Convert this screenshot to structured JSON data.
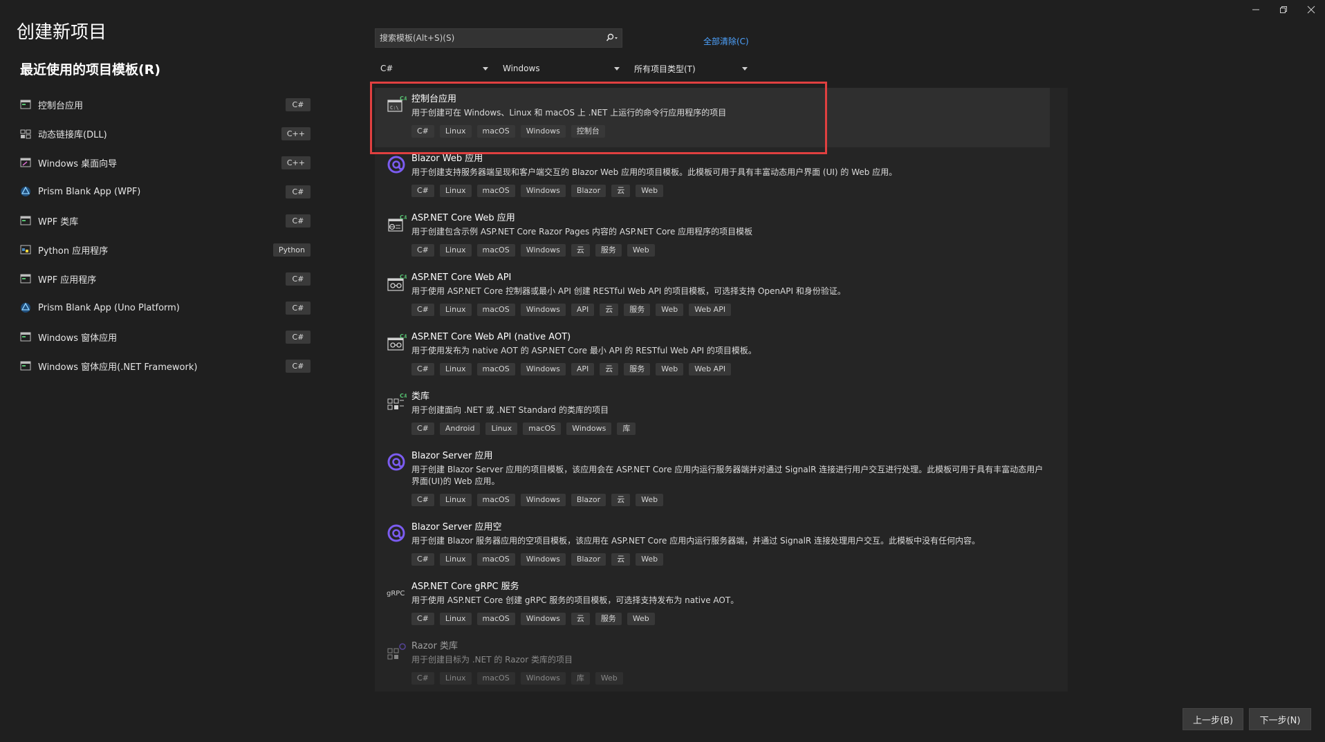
{
  "window": {
    "minimize_label": "",
    "title": "创建新项目"
  },
  "left": {
    "recent_title": "最近使用的项目模板(R)",
    "items": [
      {
        "label": "控制台应用",
        "lang": "C#"
      },
      {
        "label": "动态链接库(DLL)",
        "lang": "C++"
      },
      {
        "label": "Windows 桌面向导",
        "lang": "C++"
      },
      {
        "label": "Prism Blank App (WPF)",
        "lang": "C#"
      },
      {
        "label": "WPF 类库",
        "lang": "C#"
      },
      {
        "label": "Python 应用程序",
        "lang": "Python"
      },
      {
        "label": "WPF 应用程序",
        "lang": "C#"
      },
      {
        "label": "Prism Blank App (Uno Platform)",
        "lang": "C#"
      },
      {
        "label": "Windows 窗体应用",
        "lang": "C#"
      },
      {
        "label": "Windows 窗体应用(.NET Framework)",
        "lang": "C#"
      }
    ]
  },
  "search": {
    "placeholder": "搜索模板(Alt+S)(S)",
    "clear_all": "全部清除(C)"
  },
  "filters": {
    "language": "C#",
    "platform": "Windows",
    "project_type": "所有项目类型(T)"
  },
  "templates": [
    {
      "name": "控制台应用",
      "desc": "用于创建可在 Windows、Linux 和 macOS 上 .NET 上运行的命令行应用程序的项目",
      "tags": [
        "C#",
        "Linux",
        "macOS",
        "Windows",
        "控制台"
      ]
    },
    {
      "name": "Blazor Web 应用",
      "desc": "用于创建支持服务器端呈现和客户端交互的 Blazor Web 应用的项目模板。此模板可用于具有丰富动态用户界面 (UI) 的 Web 应用。",
      "tags": [
        "C#",
        "Linux",
        "macOS",
        "Windows",
        "Blazor",
        "云",
        "Web"
      ]
    },
    {
      "name": "ASP.NET Core Web 应用",
      "desc": "用于创建包含示例 ASP.NET Core Razor Pages 内容的 ASP.NET Core 应用程序的项目模板",
      "tags": [
        "C#",
        "Linux",
        "macOS",
        "Windows",
        "云",
        "服务",
        "Web"
      ]
    },
    {
      "name": "ASP.NET Core Web API",
      "desc": "用于使用 ASP.NET Core 控制器或最小 API 创建 RESTful Web API 的项目模板，可选择支持 OpenAPI 和身份验证。",
      "tags": [
        "C#",
        "Linux",
        "macOS",
        "Windows",
        "API",
        "云",
        "服务",
        "Web",
        "Web API"
      ]
    },
    {
      "name": "ASP.NET Core Web API (native AOT)",
      "desc": "用于使用发布为 native AOT 的 ASP.NET Core 最小 API 的 RESTful Web API 的项目模板。",
      "tags": [
        "C#",
        "Linux",
        "macOS",
        "Windows",
        "API",
        "云",
        "服务",
        "Web",
        "Web API"
      ]
    },
    {
      "name": "类库",
      "desc": "用于创建面向 .NET 或 .NET Standard 的类库的项目",
      "tags": [
        "C#",
        "Android",
        "Linux",
        "macOS",
        "Windows",
        "库"
      ]
    },
    {
      "name": "Blazor Server 应用",
      "desc": "用于创建 Blazor Server 应用的项目模板，该应用会在 ASP.NET Core 应用内运行服务器端并对通过 SignalR 连接进行用户交互进行处理。此模板可用于具有丰富动态用户界面(UI)的 Web 应用。",
      "tags": [
        "C#",
        "Linux",
        "macOS",
        "Windows",
        "Blazor",
        "云",
        "Web"
      ]
    },
    {
      "name": "Blazor Server 应用空",
      "desc": "用于创建 Blazor 服务器应用的空项目模板，该应用在 ASP.NET Core 应用内运行服务器端，并通过 SignalR 连接处理用户交互。此模板中没有任何内容。",
      "tags": [
        "C#",
        "Linux",
        "macOS",
        "Windows",
        "Blazor",
        "云",
        "Web"
      ]
    },
    {
      "name": "ASP.NET Core gRPC 服务",
      "desc": "用于使用 ASP.NET Core 创建 gRPC 服务的项目模板，可选择支持发布为 native AOT。",
      "tags": [
        "C#",
        "Linux",
        "macOS",
        "Windows",
        "云",
        "服务",
        "Web"
      ]
    },
    {
      "name": "Razor 类库",
      "desc": "用于创建目标为 .NET 的 Razor 类库的项目",
      "tags": [
        "C#",
        "Linux",
        "macOS",
        "Windows",
        "库",
        "Web"
      ]
    }
  ],
  "icons": {
    "grpc_text": "gRPC"
  },
  "buttons": {
    "back": "上一步(B)",
    "next": "下一步(N)"
  },
  "colors": {
    "accent_link": "#4ea3ff",
    "selection_outline": "#e04040",
    "blazor_purple": "#7b5cf0"
  }
}
